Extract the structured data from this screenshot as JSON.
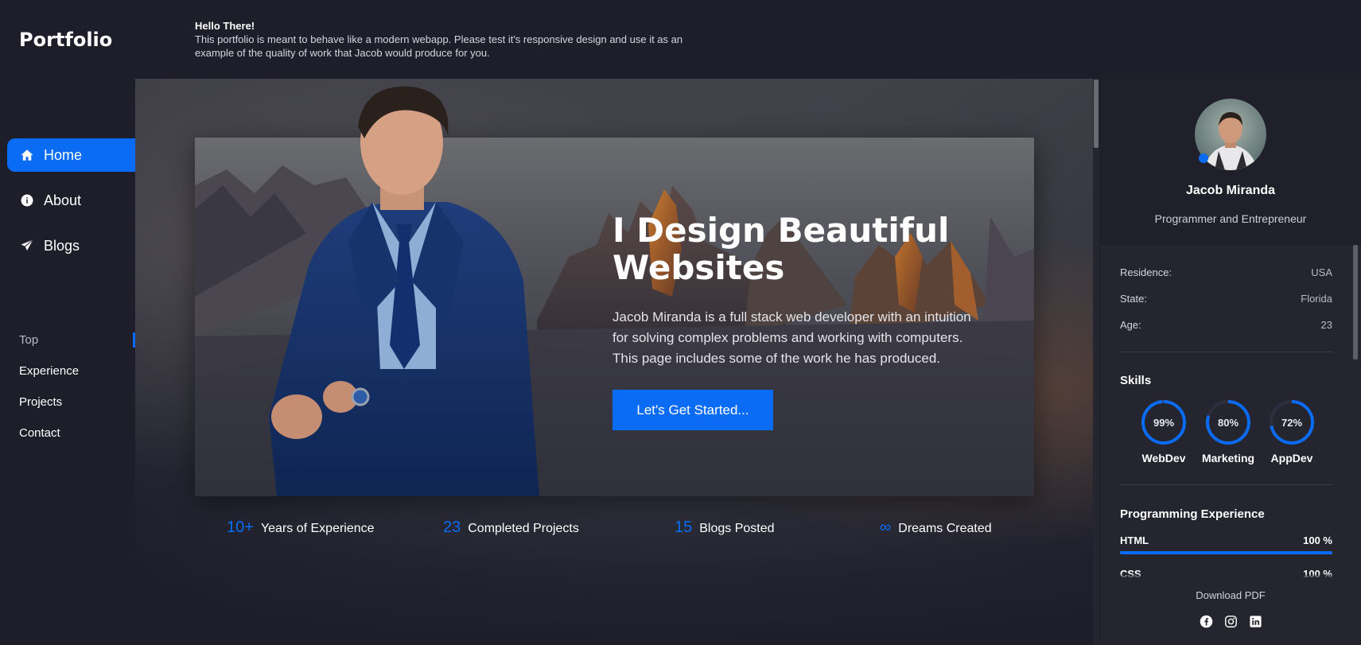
{
  "brand": "Portfolio",
  "hello": {
    "title": "Hello There!",
    "text": "This portfolio is meant to behave like a modern webapp. Please test it's responsive design and use it as an example of the quality of work that Jacob would produce for you."
  },
  "nav": {
    "items": [
      {
        "label": "Home",
        "icon": "home-icon",
        "active": true
      },
      {
        "label": "About",
        "icon": "info-icon",
        "active": false
      },
      {
        "label": "Blogs",
        "icon": "send-icon",
        "active": false
      }
    ]
  },
  "subnav": {
    "items": [
      {
        "label": "Top",
        "active": true
      },
      {
        "label": "Experience",
        "active": false
      },
      {
        "label": "Projects",
        "active": false
      },
      {
        "label": "Contact",
        "active": false
      }
    ]
  },
  "hero": {
    "title": "I Design Beautiful Websites",
    "description": "Jacob Miranda is a full stack web developer with an intuition for solving complex problems and working with computers. This page includes some of the work he has produced.",
    "cta_label": "Let's Get Started..."
  },
  "stats": [
    {
      "value": "10+",
      "label": "Years of Experience"
    },
    {
      "value": "23",
      "label": "Completed Projects"
    },
    {
      "value": "15",
      "label": "Blogs Posted"
    },
    {
      "value": "∞",
      "label": "Dreams Created"
    }
  ],
  "profile": {
    "name": "Jacob Miranda",
    "role": "Programmer and Entrepreneur",
    "info": [
      {
        "key": "Residence:",
        "value": "USA"
      },
      {
        "key": "State:",
        "value": "Florida"
      },
      {
        "key": "Age:",
        "value": "23"
      }
    ],
    "skills_title": "Skills",
    "skills": [
      {
        "name": "WebDev",
        "percent_label": "99%",
        "percent": 99
      },
      {
        "name": "Marketing",
        "percent_label": "80%",
        "percent": 80
      },
      {
        "name": "AppDev",
        "percent_label": "72%",
        "percent": 72
      }
    ],
    "programming_title": "Programming Experience",
    "programming": [
      {
        "name": "HTML",
        "percent_label": "100 %",
        "percent": 100
      },
      {
        "name": "CSS",
        "percent_label": "100 %",
        "percent": 100
      }
    ],
    "download_label": "Download PDF",
    "socials": [
      "facebook-icon",
      "instagram-icon",
      "linkedin-icon"
    ]
  },
  "colors": {
    "accent": "#0a6cf5",
    "background": "#1d1e2a",
    "panel": "#24252f"
  }
}
